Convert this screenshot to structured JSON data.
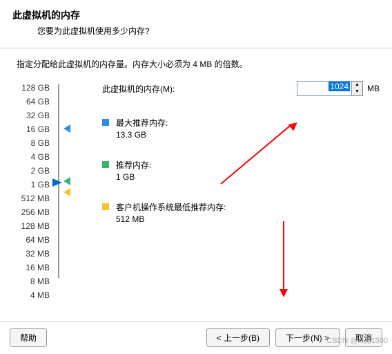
{
  "header": {
    "title": "此虚拟机的内存",
    "subtitle": "您要为此虚拟机使用多少内存?"
  },
  "description": "指定分配给此虚拟机的内存量。内存大小必须为 4 MB 的倍数。",
  "memory": {
    "label": "此虚拟机的内存(M):",
    "value": "1024",
    "unit": "MB"
  },
  "ticks": [
    "128 GB",
    "64 GB",
    "32 GB",
    "16 GB",
    "8 GB",
    "4 GB",
    "2 GB",
    "1 GB",
    "512 MB",
    "256 MB",
    "128 MB",
    "64 MB",
    "32 MB",
    "16 MB",
    "8 MB",
    "4 MB"
  ],
  "recommendations": {
    "max": {
      "label": "最大推荐内存:",
      "value": "13.3 GB"
    },
    "recommended": {
      "label": "推荐内存:",
      "value": "1 GB"
    },
    "min": {
      "label": "客户机操作系统最低推荐内存:",
      "value": "512 MB"
    }
  },
  "buttons": {
    "help": "帮助",
    "back": "< 上一步(B)",
    "next": "下一步(N) >",
    "cancel": "取消"
  },
  "watermark": "CSDN @xl美1500"
}
